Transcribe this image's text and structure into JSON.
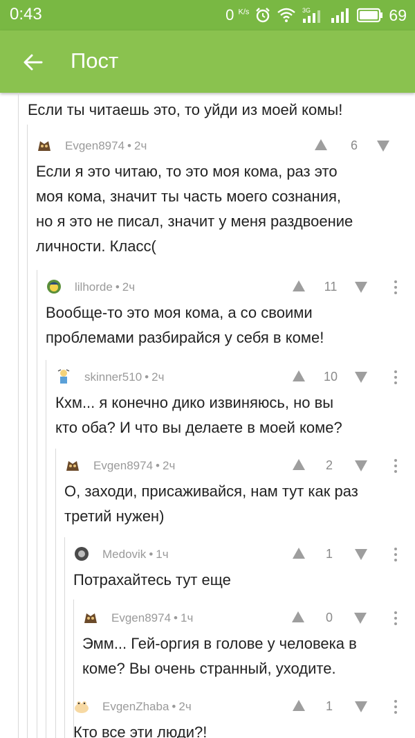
{
  "status_bar": {
    "time": "0:43",
    "speed": "0",
    "speed_unit": "K/s",
    "network": "3G",
    "battery": "69",
    "icons": [
      "alarm-icon",
      "wifi-icon",
      "signal-3g-icon",
      "signal-icon",
      "battery-icon"
    ]
  },
  "app_bar": {
    "title": "Пост",
    "back_icon": "arrow-left-icon"
  },
  "colors": {
    "status_bar": "#79b843",
    "app_bar": "#8ac24f",
    "meta": "#9a9a9a",
    "vote": "#9e9e9e"
  },
  "top_text": "Если ты читаешь это, то уйди из моей комы!",
  "comments": [
    {
      "author": "Evgen8974",
      "time": "2ч",
      "score": "6",
      "lines": [
        "Если я это читаю, то это моя кома, раз это",
        "моя кома, значит ты часть моего сознания,",
        "но я это не писал, значит у меня раздвоение",
        "личности. Класс("
      ]
    },
    {
      "author": "lilhorde",
      "time": "2ч",
      "score": "11",
      "lines": [
        "Вообще-то это моя кома, а со своими",
        "проблемами разбирайся у себя в коме!"
      ]
    },
    {
      "author": "skinner510",
      "time": "2ч",
      "score": "10",
      "lines": [
        "Кхм... я конечно дико извиняюсь, но вы",
        "кто оба? И что вы делаете в моей коме?"
      ]
    },
    {
      "author": "Evgen8974",
      "time": "2ч",
      "score": "2",
      "lines": [
        "О, заходи, присаживайся, нам тут как раз",
        "третий нужен)"
      ]
    },
    {
      "author": "Medovik",
      "time": "1ч",
      "score": "1",
      "lines": [
        "Потрахайтесь тут еще"
      ]
    },
    {
      "author": "Evgen8974",
      "time": "1ч",
      "score": "0",
      "lines": [
        "Эмм... Гей-оргия в голове у человека в",
        "коме? Вы очень странный, уходите."
      ]
    },
    {
      "author": "EvgenZhaba",
      "time": "2ч",
      "score": "1",
      "lines": [
        "Кто все эти люди?!"
      ]
    }
  ]
}
